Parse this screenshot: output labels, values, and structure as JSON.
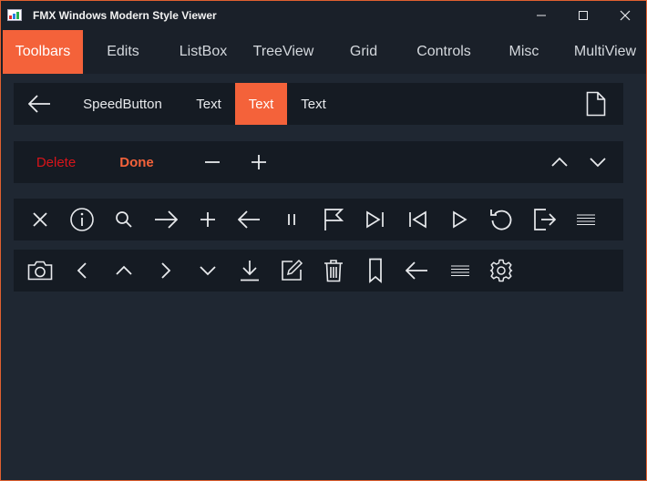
{
  "window": {
    "title": "FMX Windows Modern Style Viewer",
    "controls": [
      "minimize",
      "maximize",
      "close"
    ]
  },
  "tabs": [
    {
      "label": "Toolbars",
      "active": true
    },
    {
      "label": "Edits",
      "active": false
    },
    {
      "label": "ListBox",
      "active": false
    },
    {
      "label": "TreeView",
      "active": false
    },
    {
      "label": "Grid",
      "active": false
    },
    {
      "label": "Controls",
      "active": false
    },
    {
      "label": "Misc",
      "active": false
    },
    {
      "label": "MultiView",
      "active": false
    }
  ],
  "toolbar1": {
    "back_icon": "arrow-left-icon",
    "items": [
      "SpeedButton",
      "Text",
      "Text",
      "Text"
    ],
    "active_index": 2,
    "right_icon": "document-icon"
  },
  "toolbar2": {
    "delete_label": "Delete",
    "done_label": "Done",
    "icons": [
      "minus-icon",
      "plus-icon",
      "chevron-up-icon",
      "chevron-down-icon"
    ]
  },
  "toolbar3": {
    "icons": [
      "close-icon",
      "info-icon",
      "search-icon",
      "arrow-right-icon",
      "plus-icon",
      "arrow-left-icon",
      "pause-icon",
      "flag-icon",
      "skip-next-icon",
      "skip-previous-icon",
      "play-icon",
      "refresh-icon",
      "exit-icon",
      "menu-icon"
    ]
  },
  "toolbar4": {
    "icons": [
      "camera-icon",
      "chevron-left-icon",
      "chevron-up-icon",
      "chevron-right-icon",
      "chevron-down-icon",
      "download-icon",
      "compose-icon",
      "trash-icon",
      "bookmark-icon",
      "arrow-left-icon",
      "menu-icon",
      "gear-icon"
    ]
  },
  "colors": {
    "accent": "#f4623a",
    "background": "#1f2732",
    "panel": "#151b23",
    "delete": "#d8141a"
  }
}
